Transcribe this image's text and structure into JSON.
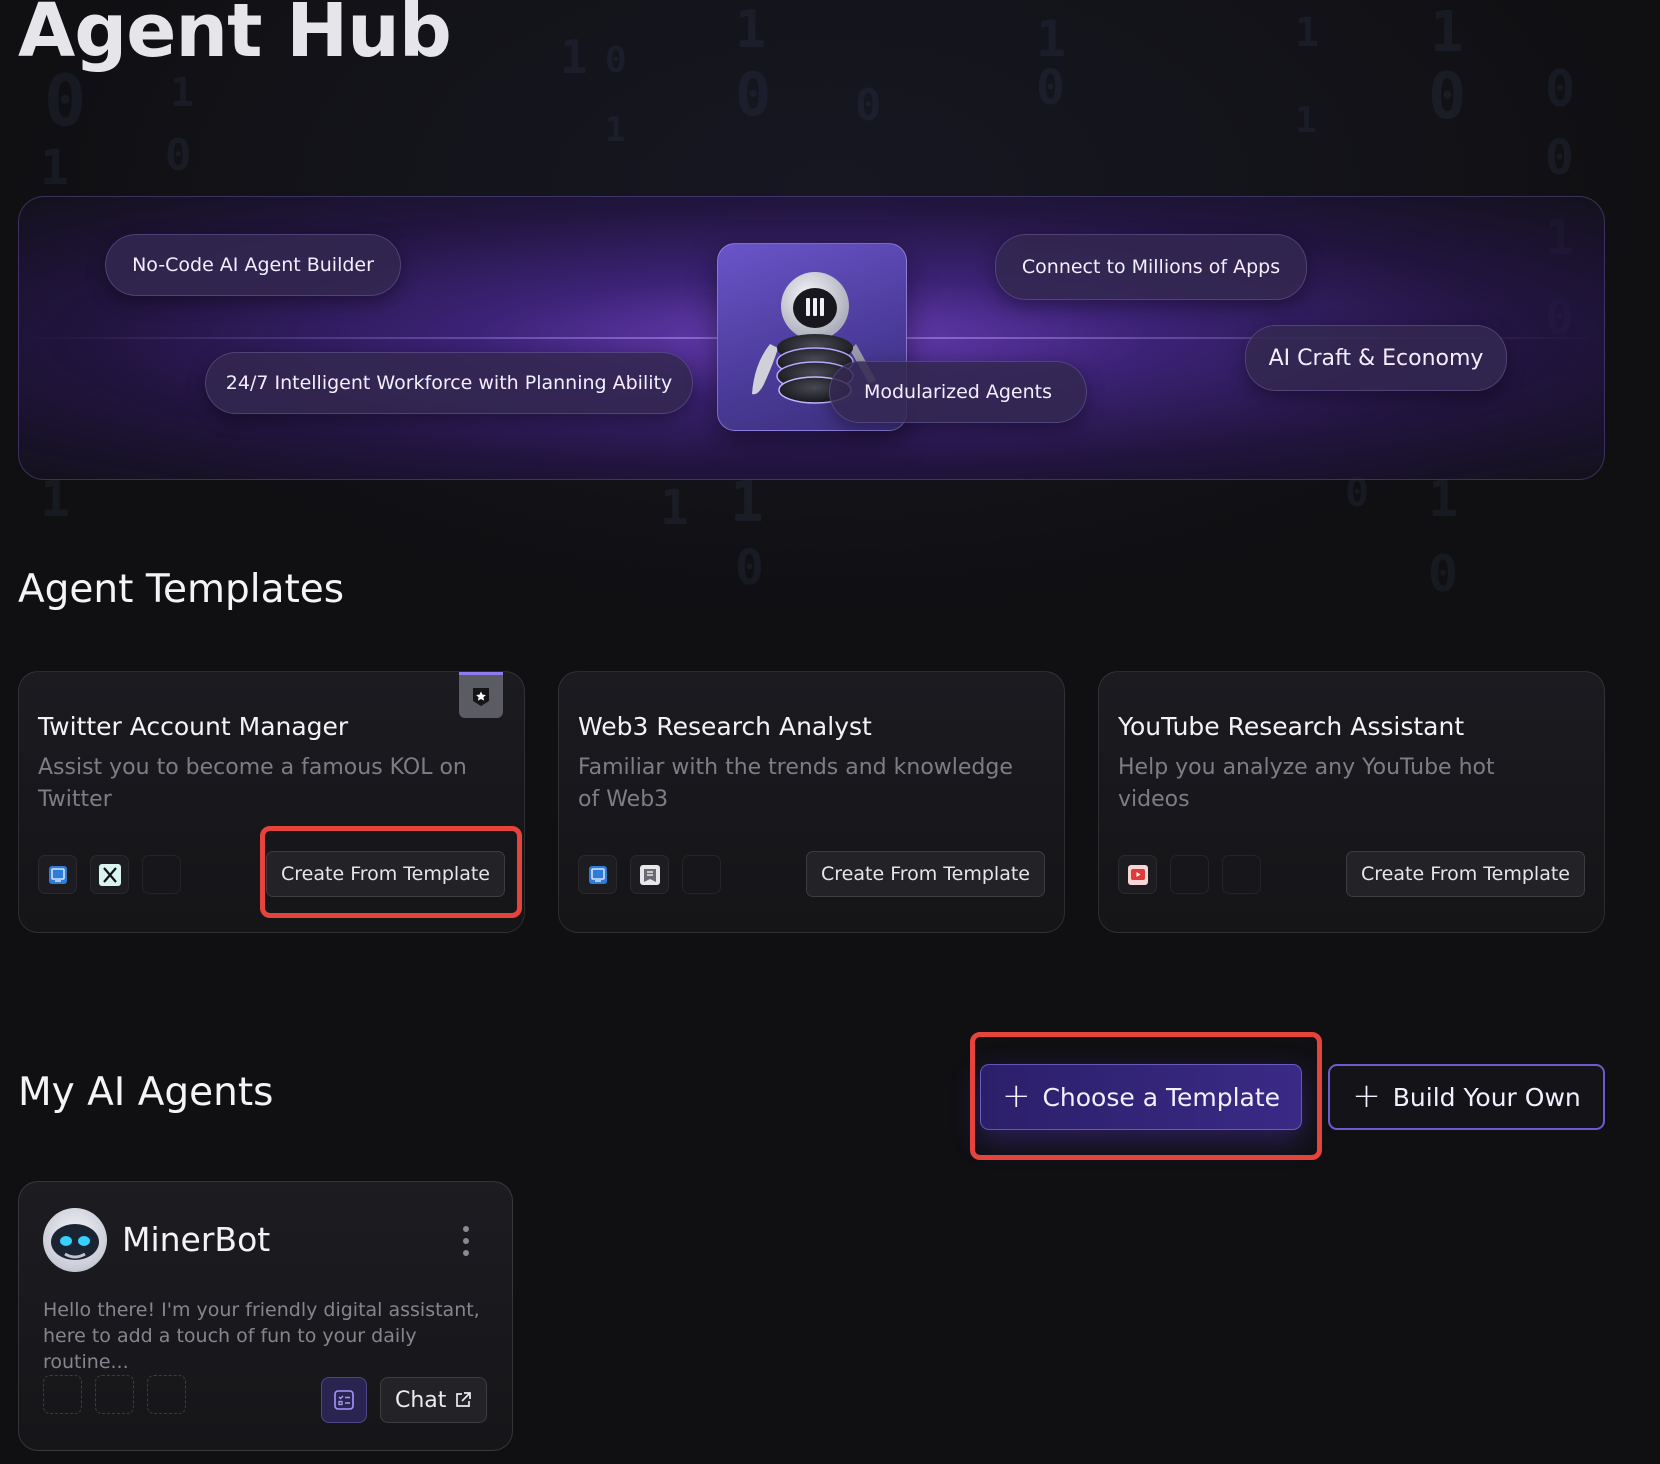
{
  "page": {
    "title": "Agent Hub"
  },
  "banner": {
    "pills": [
      "No-Code AI Agent Builder",
      "24/7 Intelligent Workforce with Planning Ability",
      "Connect to Millions of Apps",
      "Modularized Agents",
      "AI Craft & Economy"
    ],
    "mascot_icon": "robot-mascot-icon"
  },
  "templates": {
    "heading": "Agent Templates",
    "cards": [
      {
        "title": "Twitter Account Manager",
        "description": "Assist you to become a famous KOL on Twitter",
        "tools": [
          "browser-tool-icon",
          "x-twitter-icon"
        ],
        "button": "Create From Template",
        "badge_icon": "star-badge-icon"
      },
      {
        "title": "Web3 Research Analyst",
        "description": "Familiar with the trends and knowledge of Web3",
        "tools": [
          "browser-tool-icon",
          "reader-tool-icon"
        ],
        "button": "Create From Template"
      },
      {
        "title": "YouTube Research Assistant",
        "description": "Help you analyze any YouTube hot videos",
        "tools": [
          "youtube-icon"
        ],
        "button": "Create From Template"
      }
    ]
  },
  "my_agents": {
    "heading": "My AI Agents",
    "choose_template_label": "Choose a Template",
    "build_own_label": "Build Your Own",
    "agents": [
      {
        "name": "MinerBot",
        "description": "Hello there! I'm your friendly digital assistant, here to add a touch of fun to your daily routine...",
        "chat_label": "Chat"
      }
    ]
  },
  "colors": {
    "background": "#101013",
    "accent": "#6c5ad0",
    "highlight": "#e5443c"
  }
}
